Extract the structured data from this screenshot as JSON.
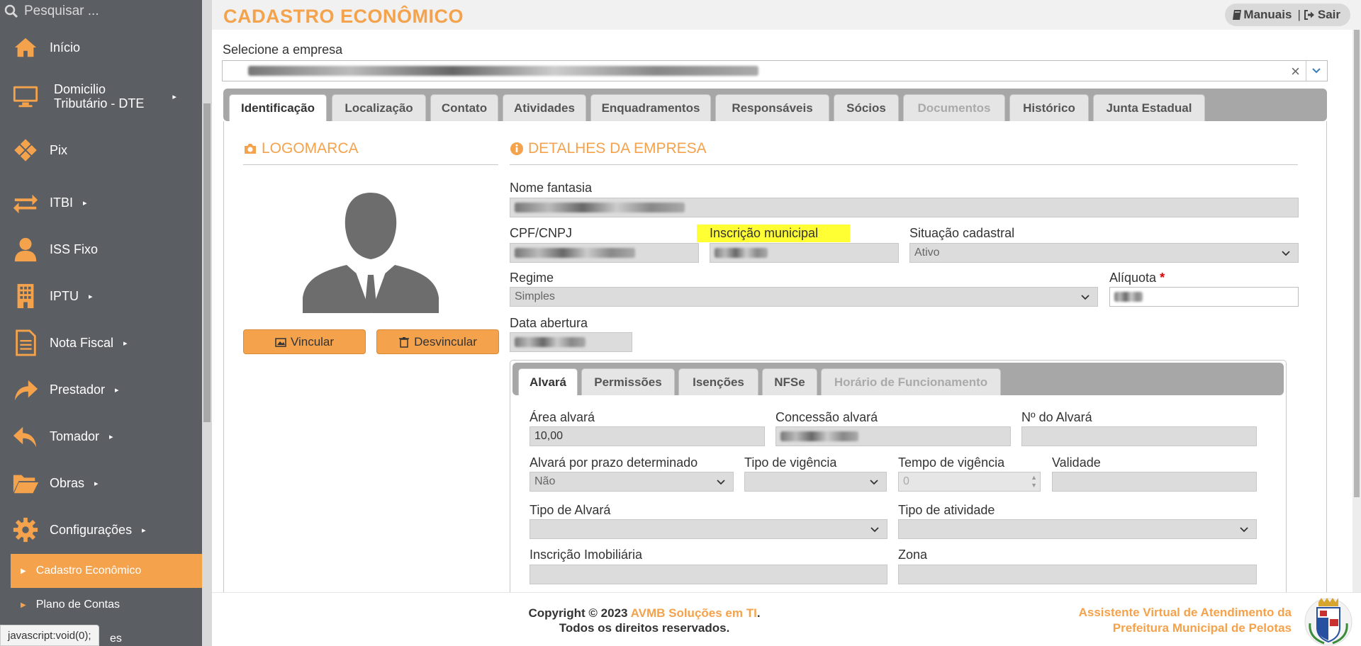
{
  "sidebar": {
    "search_placeholder": "Pesquisar ...",
    "items": [
      {
        "label": "Início",
        "icon": "home-icon"
      },
      {
        "label": "Domicílio Tributário - DTE",
        "line1": "Domicilio",
        "line2": "Tributário - DTE",
        "icon": "monitor-icon",
        "arrow": "▸"
      },
      {
        "label": "Pix",
        "icon": "pix-icon"
      },
      {
        "label": "ITBI",
        "icon": "exchange-icon",
        "arrow": "▸"
      },
      {
        "label": "ISS Fixo",
        "icon": "user-icon"
      },
      {
        "label": "IPTU",
        "icon": "building-icon",
        "arrow": "▸"
      },
      {
        "label": "Nota Fiscal",
        "icon": "document-icon",
        "arrow": "▸"
      },
      {
        "label": "Prestador",
        "icon": "share-icon",
        "arrow": "▸"
      },
      {
        "label": "Tomador",
        "icon": "reply-icon",
        "arrow": "▸"
      },
      {
        "label": "Obras",
        "icon": "folder-open-icon",
        "arrow": "▸"
      },
      {
        "label": "Configurações",
        "icon": "gear-icon",
        "arrow": "▸"
      }
    ],
    "sub_items": [
      {
        "label": "Cadastro Econômico",
        "active": true
      },
      {
        "label": "Plano de Contas",
        "active": false
      },
      {
        "label": "es",
        "active": false
      }
    ]
  },
  "status_bar": "javascript:void(0);",
  "header": {
    "title": "CADASTRO ECONÔMICO",
    "manuais": "Manuais",
    "separator": "|",
    "sair": "Sair"
  },
  "empresa": {
    "label": "Selecione a empresa",
    "clear": "×"
  },
  "tabs": [
    "Identificação",
    "Localização",
    "Contato",
    "Atividades",
    "Enquadramentos",
    "Responsáveis",
    "Sócios",
    "Documentos",
    "Histórico",
    "Junta Estadual"
  ],
  "logomarca": {
    "title": "LOGOMARCA",
    "vincular": "Vincular",
    "desvincular": "Desvincular"
  },
  "detalhes": {
    "title": "DETALHES DA EMPRESA",
    "nome_fantasia": "Nome fantasia",
    "cpf_cnpj": "CPF/CNPJ",
    "inscricao_municipal": "Inscrição municipal",
    "situacao_cadastral": "Situação cadastral",
    "situacao_value": "Ativo",
    "regime": "Regime",
    "regime_value": "Simples",
    "aliquota": "Alíquota",
    "required": "*",
    "data_abertura": "Data abertura"
  },
  "subtabs": [
    "Alvará",
    "Permissões",
    "Isenções",
    "NFSe",
    "Horário de Funcionamento"
  ],
  "alvara": {
    "area_label": "Área alvará",
    "area_value": "10,00",
    "concessao_label": "Concessão alvará",
    "numero_label": "Nº do Alvará",
    "prazo_label": "Alvará por prazo determinado",
    "prazo_value": "Não",
    "tipo_vigencia_label": "Tipo de vigência",
    "tempo_vigencia_label": "Tempo de vigência",
    "tempo_vigencia_value": "0",
    "validade_label": "Validade",
    "tipo_alvara_label": "Tipo de Alvará",
    "tipo_atividade_label": "Tipo de atividade",
    "inscricao_imob_label": "Inscrição Imobiliária",
    "zona_label": "Zona"
  },
  "footer": {
    "copyright": "Copyright © 2023",
    "org": "AVMB Soluções em TI",
    "dot": ".",
    "rights": "Todos os direitos reservados.",
    "assist_line1": "Assistente Virtual de Atendimento da",
    "assist_line2": "Prefeitura Municipal de Pelotas"
  },
  "colors": {
    "accent": "#f4a24c",
    "sidebar": "#5b5e63",
    "highlight": "#ffff33"
  }
}
